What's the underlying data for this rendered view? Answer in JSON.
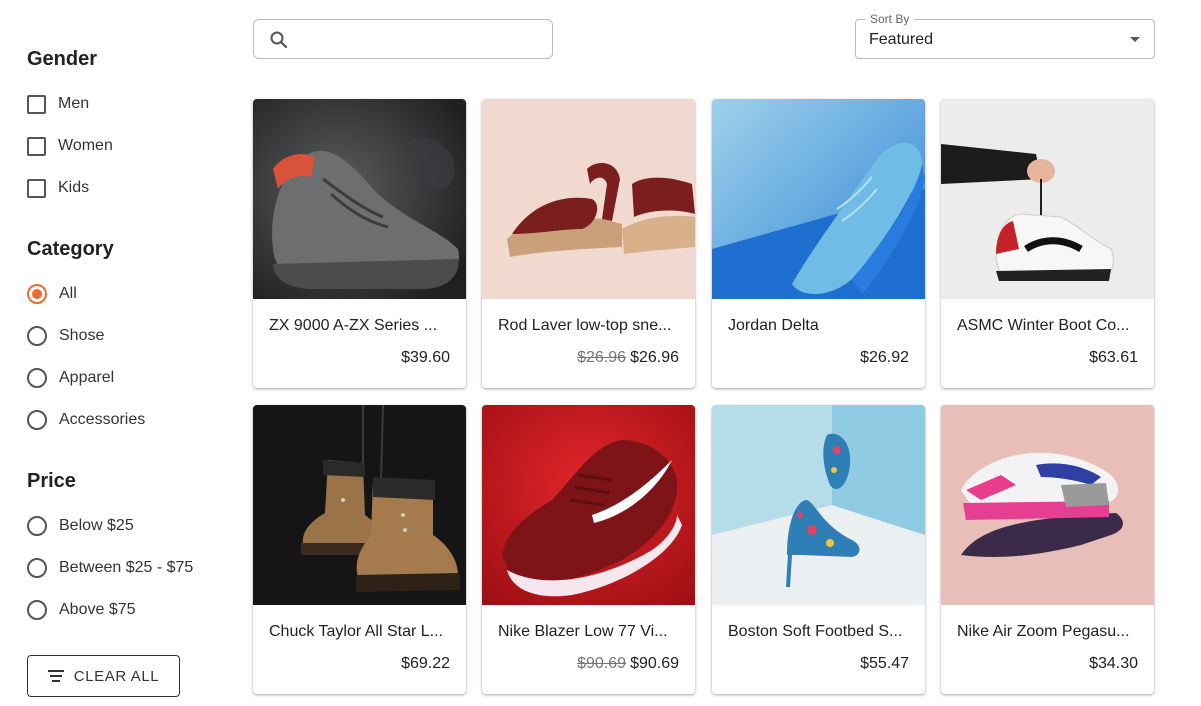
{
  "filters": {
    "gender": {
      "title": "Gender",
      "options": [
        {
          "label": "Men",
          "checked": false
        },
        {
          "label": "Women",
          "checked": false
        },
        {
          "label": "Kids",
          "checked": false
        }
      ]
    },
    "category": {
      "title": "Category",
      "options": [
        {
          "label": "All",
          "selected": true
        },
        {
          "label": "Shose",
          "selected": false
        },
        {
          "label": "Apparel",
          "selected": false
        },
        {
          "label": "Accessories",
          "selected": false
        }
      ]
    },
    "price": {
      "title": "Price",
      "options": [
        {
          "label": "Below $25",
          "selected": false
        },
        {
          "label": "Between $25 - $75",
          "selected": false
        },
        {
          "label": "Above $75",
          "selected": false
        }
      ]
    },
    "clear_label": "CLEAR ALL"
  },
  "search": {
    "value": "",
    "placeholder": ""
  },
  "sort": {
    "label": "Sort By",
    "value": "Featured"
  },
  "colors": {
    "accent": "#f0692d",
    "border": "#bbbbbb"
  },
  "products": [
    {
      "title": "ZX 9000 A-ZX Series ...",
      "price": "$39.60",
      "old_price": ""
    },
    {
      "title": "Rod Laver low-top sne...",
      "price": "$26.96",
      "old_price": "$26.96"
    },
    {
      "title": "Jordan Delta",
      "price": "$26.92",
      "old_price": ""
    },
    {
      "title": "ASMC Winter Boot Co...",
      "price": "$63.61",
      "old_price": ""
    },
    {
      "title": "Chuck Taylor All Star L...",
      "price": "$69.22",
      "old_price": ""
    },
    {
      "title": "Nike Blazer Low 77 Vi...",
      "price": "$90.69",
      "old_price": "$90.69"
    },
    {
      "title": "Boston Soft Footbed S...",
      "price": "$55.47",
      "old_price": ""
    },
    {
      "title": "Nike Air Zoom Pegasu...",
      "price": "$34.30",
      "old_price": ""
    }
  ]
}
